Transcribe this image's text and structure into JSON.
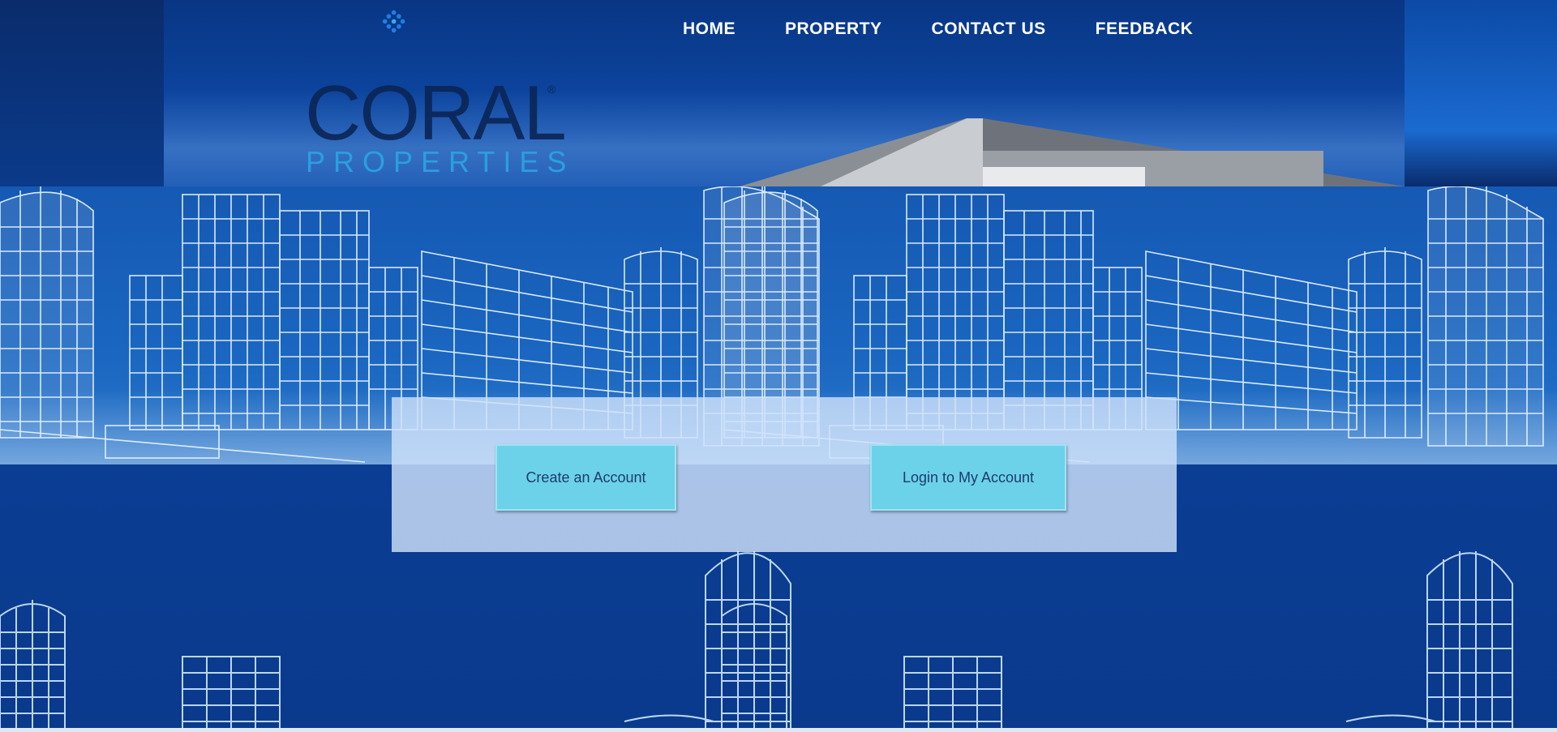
{
  "brand": {
    "name": "CORAL",
    "tagline": "PROPERTIES",
    "registered_mark": "®",
    "logo_icon": "coral-dots-icon"
  },
  "nav": {
    "items": [
      {
        "label": "HOME"
      },
      {
        "label": "PROPERTY"
      },
      {
        "label": "CONTACT US"
      },
      {
        "label": "FEEDBACK"
      }
    ]
  },
  "actions": {
    "create_account": "Create an Account",
    "login": "Login to My Account"
  },
  "colors": {
    "background": "#0a3a8c",
    "header": "#0d49a7",
    "panel": "#cde1fa",
    "button": "#6cd2ea",
    "button_text": "#1d3c6e",
    "logo_dark": "#0b2556",
    "logo_accent": "#2a9fe0"
  }
}
